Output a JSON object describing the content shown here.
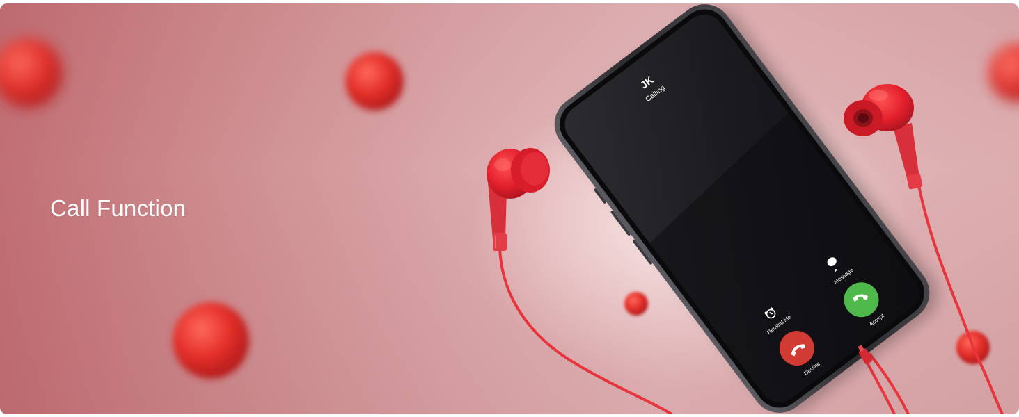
{
  "banner": {
    "headline": "Call Function"
  },
  "phone": {
    "caller_name": "JK",
    "call_status": "Calling",
    "actions": {
      "message": "Message",
      "remind_me": "Remind Me",
      "accept": "Accept",
      "decline": "Decline"
    }
  },
  "colors": {
    "accent_red": "#e2252c",
    "accept_green": "#4fb84a",
    "decline_red": "#d13b33",
    "screen": "#1b1b1f"
  },
  "icons": {
    "message": "speech-bubble-icon",
    "remind_me": "alarm-clock-icon",
    "accept": "phone-handset-icon",
    "decline": "phone-hangup-icon"
  }
}
